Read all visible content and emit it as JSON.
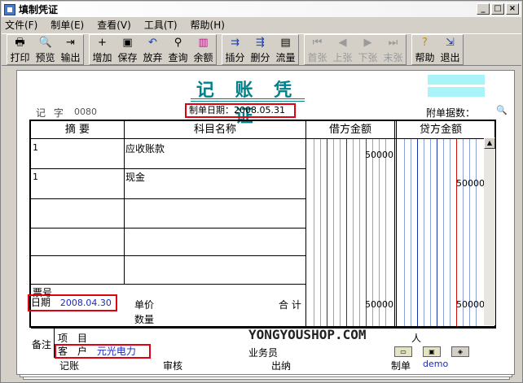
{
  "window": {
    "title": "填制凭证"
  },
  "menu": [
    "文件(F)",
    "制单(E)",
    "查看(V)",
    "工具(T)",
    "帮助(H)"
  ],
  "toolbar": {
    "g1": [
      {
        "label": "打印",
        "icon": "print-icon"
      },
      {
        "label": "预览",
        "icon": "preview-icon"
      },
      {
        "label": "输出",
        "icon": "export-icon"
      }
    ],
    "g2": [
      {
        "label": "增加",
        "icon": "add-icon"
      },
      {
        "label": "保存",
        "icon": "save-icon"
      },
      {
        "label": "放弃",
        "icon": "undo-icon"
      },
      {
        "label": "查询",
        "icon": "binoculars-icon"
      },
      {
        "label": "余额",
        "icon": "balance-chart-icon"
      }
    ],
    "g3": [
      {
        "label": "插分",
        "icon": "insert-row-icon"
      },
      {
        "label": "删分",
        "icon": "delete-row-icon"
      },
      {
        "label": "流量",
        "icon": "cashflow-icon"
      }
    ],
    "g4": [
      {
        "label": "首张",
        "icon": "first-icon"
      },
      {
        "label": "上张",
        "icon": "prev-icon"
      },
      {
        "label": "下张",
        "icon": "next-icon"
      },
      {
        "label": "末张",
        "icon": "last-icon"
      }
    ],
    "g5": [
      {
        "label": "帮助",
        "icon": "help-icon"
      },
      {
        "label": "退出",
        "icon": "exit-icon"
      }
    ]
  },
  "voucher": {
    "title": "记 账 凭 证",
    "code_label": "记 字",
    "code_num": "0080",
    "date_text": "制单日期：2008.05.31",
    "attach_label": "附单据数：",
    "headers": {
      "summary": "摘 要",
      "account": "科目名称",
      "debit": "借方金额",
      "credit": "贷方金额"
    },
    "rows": [
      {
        "summary": "1",
        "account": "应收账款",
        "debit": "50000",
        "credit": ""
      },
      {
        "summary": "1",
        "account": "现金",
        "debit": "",
        "credit": "50000"
      }
    ],
    "bill_no_label": "票号",
    "bill_date_label": "日期",
    "bill_date_value": "2008.04.30",
    "unit_price_label": "单价",
    "qty_label": "数量",
    "total_label": "合 计",
    "total_debit": "50000",
    "total_credit": "50000",
    "remark_label": "备注",
    "project_label": "项　目",
    "customer_label": "客　户",
    "customer_value": "元光电力",
    "person_label": "人",
    "salesman_label": "业务员",
    "watermark": "YONGYOUSHOP.COM"
  },
  "footer": {
    "bookkeeper": "记账",
    "auditor": "审核",
    "cashier": "出纳",
    "maker": "制单",
    "maker_value": "demo"
  }
}
